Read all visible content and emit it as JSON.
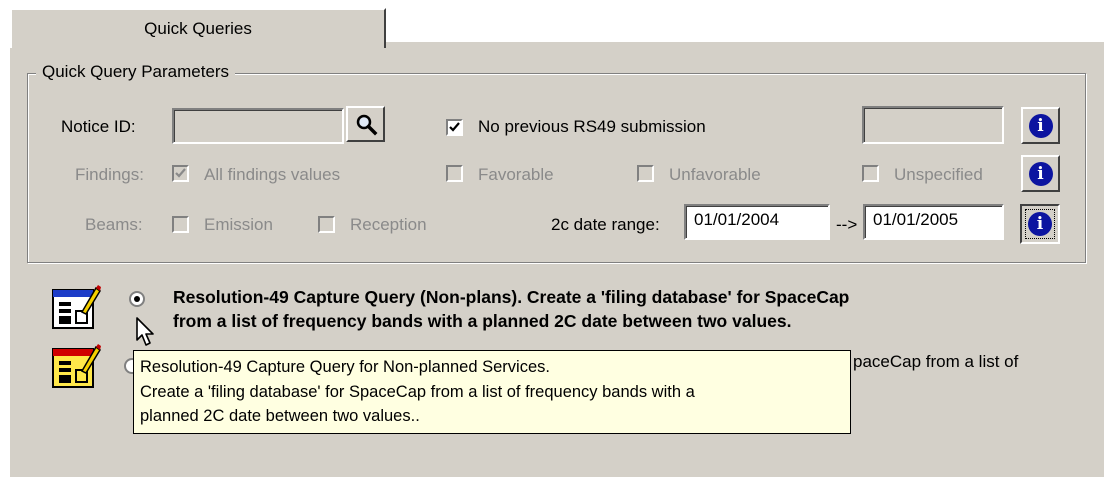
{
  "tab": {
    "label": "Quick Queries"
  },
  "group": {
    "legend": "Quick Query Parameters",
    "notice_id": {
      "label": "Notice ID:",
      "value": ""
    },
    "no_previous": {
      "label": "No previous RS49 submission",
      "checked": true
    },
    "right_field": {
      "value": ""
    },
    "findings": {
      "label": "Findings:",
      "all": "All findings values",
      "favorable": "Favorable",
      "unfavorable": "Unfavorable",
      "unspecified": "Unspecified"
    },
    "beams": {
      "label": "Beams:",
      "emission": "Emission",
      "reception": "Reception"
    },
    "date_range": {
      "label": "2c date range:",
      "from": "01/01/2004",
      "arrow": "-->",
      "to": "01/01/2005"
    }
  },
  "queries": {
    "q1": {
      "line1": "Resolution-49 Capture Query (Non-plans). Create a 'filing database' for SpaceCap",
      "line2": "from a list of frequency bands with a planned 2C date between two values."
    },
    "q2": {
      "partial": "paceCap from a list of"
    }
  },
  "tooltip": {
    "line1": "Resolution-49 Capture Query for Non-planned Services.",
    "line2": "Create a 'filing database' for SpaceCap from a list of frequency bands with a",
    "line3": "planned 2C date between two values.."
  },
  "icons": {
    "search": "magnifier-icon",
    "info": "info-icon",
    "query": "form-pencil-icon",
    "cursor": "arrow-cursor-icon"
  },
  "colors": {
    "panel": "#d4d0c8",
    "info_blue": "#0c14a0",
    "tooltip_bg": "#ffffe1"
  }
}
